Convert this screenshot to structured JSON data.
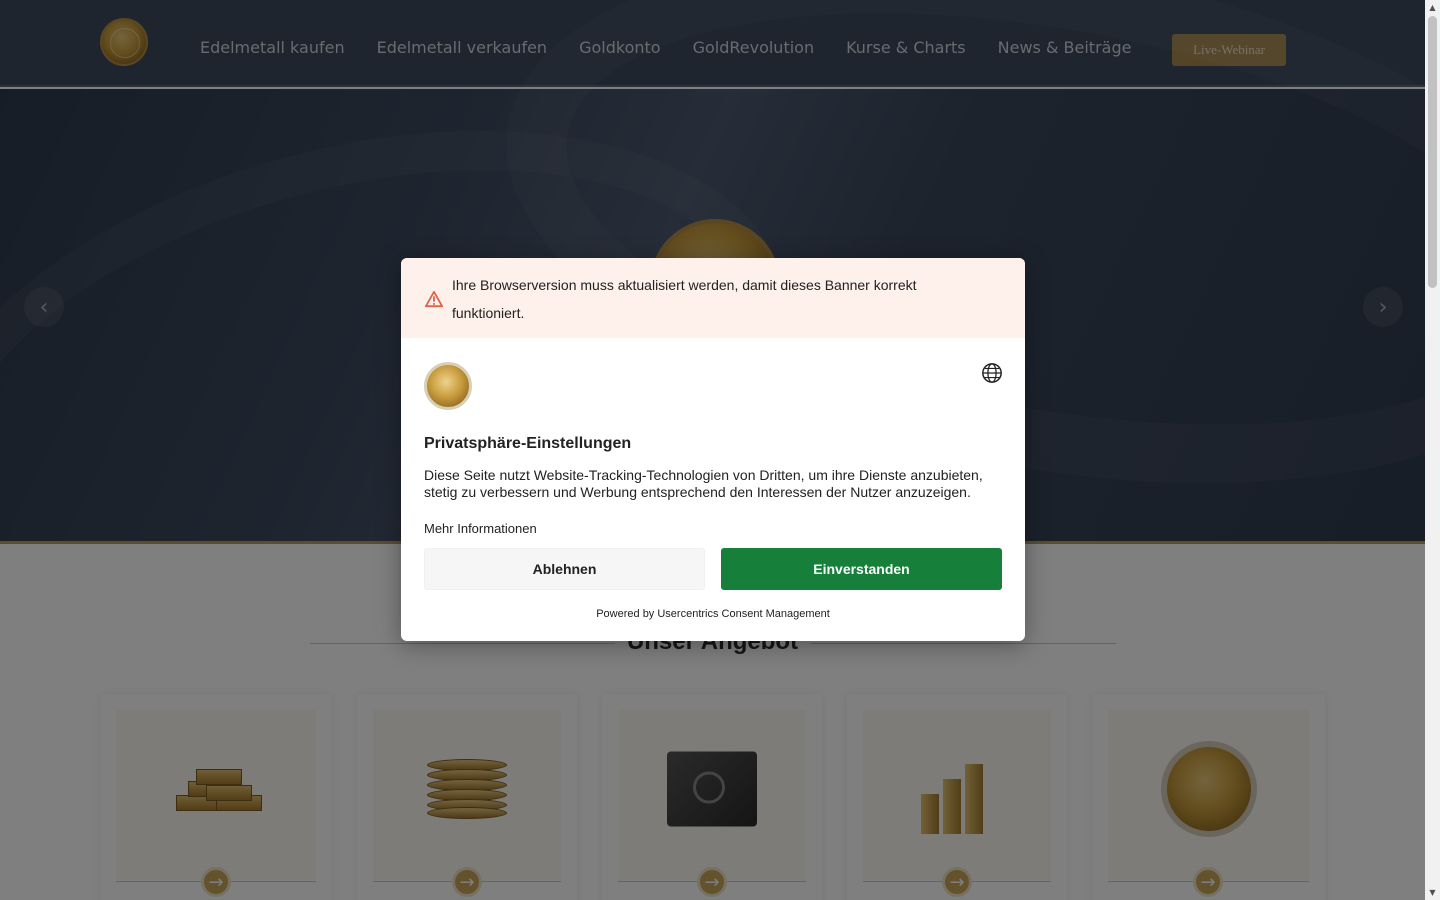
{
  "nav": {
    "items": [
      "Edelmetall kaufen",
      "Edelmetall verkaufen",
      "Goldkonto",
      "GoldRevolution",
      "Kurse & Charts",
      "News & Beiträge"
    ],
    "webinar_label": "Live-Webinar"
  },
  "hero": {
    "prev_label": "‹",
    "next_label": "›"
  },
  "offer": {
    "title": "Unser Angebot",
    "cards": [
      {
        "icon": "gold-bars-icon"
      },
      {
        "icon": "coin-stack-icon"
      },
      {
        "icon": "safe-icon"
      },
      {
        "icon": "growth-chart-icon"
      },
      {
        "icon": "gold-coin-icon"
      }
    ],
    "card_arrow": "→"
  },
  "consent": {
    "warning": "Ihre Browserversion muss aktualisiert werden, damit dieses Banner korrekt funktioniert.",
    "title": "Privatsphäre-Einstellungen",
    "body": "Diese Seite nutzt Website-Tracking-Technologien von Dritten, um ihre Dienste anzubieten, stetig zu verbessern und Werbung entsprechend den Interessen der Nutzer anzuzeigen.",
    "more_info": "Mehr Informationen",
    "decline": "Ablehnen",
    "accept": "Einverstanden",
    "powered_by": "Powered by Usercentrics Consent Management"
  },
  "colors": {
    "header_bg": "#3c4a5e",
    "gold_accent": "#a88a52",
    "accept_green": "#167f3a",
    "warning_bg": "#fef0ea",
    "warning_icon": "#e0624a"
  }
}
